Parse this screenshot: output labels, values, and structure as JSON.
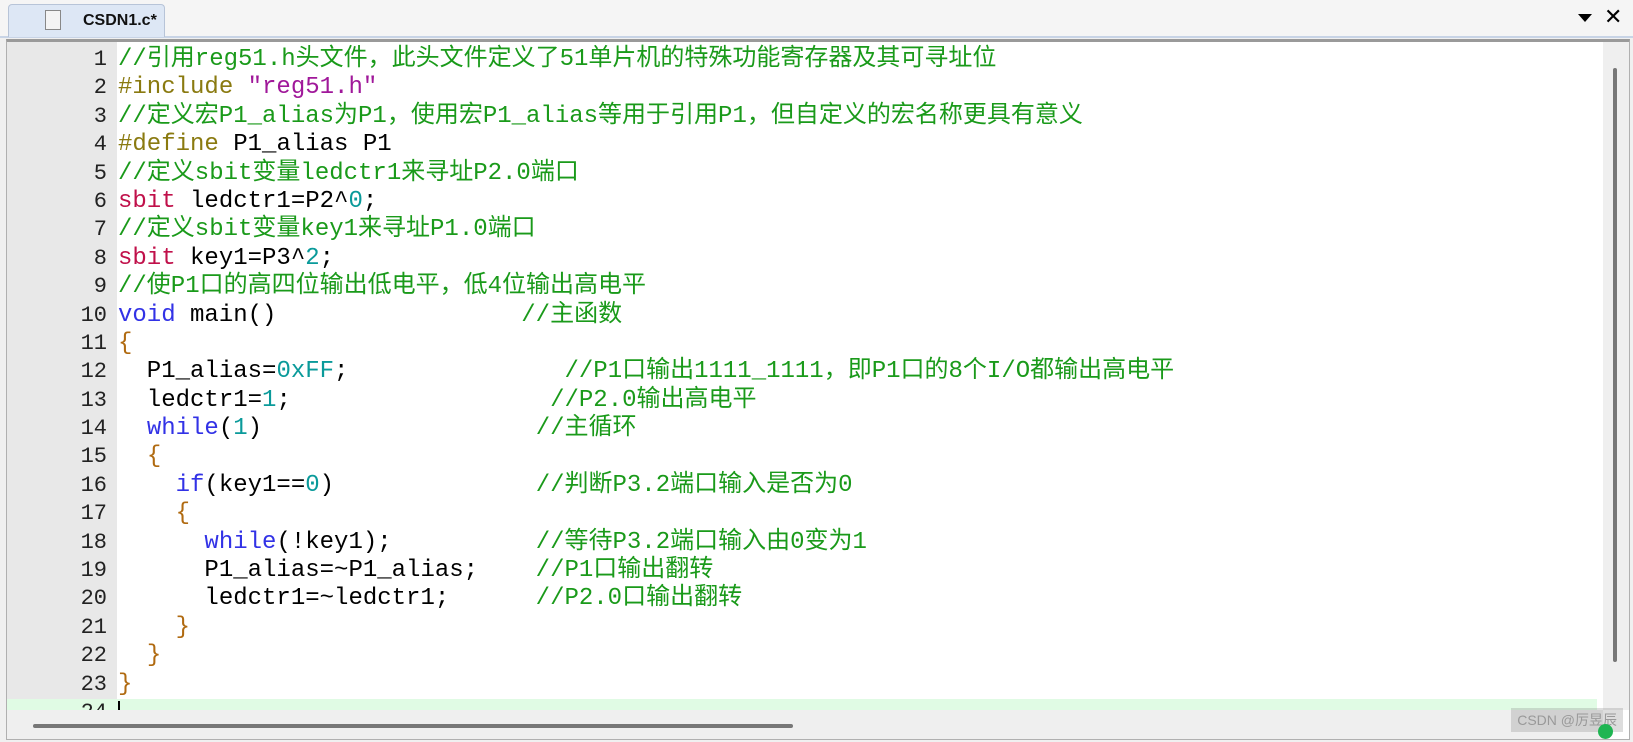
{
  "tab": {
    "title": "CSDN1.c*"
  },
  "watermark": "CSDN @厉昱辰",
  "colors": {
    "comment": "#1a9a1a",
    "keyword": "#3232e6",
    "type": "#c0104a",
    "preprocessor": "#8a7a10",
    "string": "#a0189a",
    "number": "#0a9a9a",
    "current_line": "#e0fbe4"
  },
  "editor": {
    "current_line": 24,
    "lines": [
      [
        [
          "comment",
          "//引用reg51.h头文件，此头文件定义了51单片机的特殊功能寄存器及其可寻址位"
        ]
      ],
      [
        [
          "pre",
          "#include "
        ],
        [
          "string",
          "\"reg51.h\""
        ]
      ],
      [
        [
          "comment",
          "//定义宏P1_alias为P1，使用宏P1_alias等用于引用P1，但自定义的宏名称更具有意义"
        ]
      ],
      [
        [
          "pre",
          "#define"
        ],
        [
          "plain",
          " P1_alias P1"
        ]
      ],
      [
        [
          "comment",
          "//定义sbit变量ledctr1来寻址P2.0端口"
        ]
      ],
      [
        [
          "type",
          "sbit"
        ],
        [
          "plain",
          " ledctr1=P2^"
        ],
        [
          "number",
          "0"
        ],
        [
          "plain",
          ";"
        ]
      ],
      [
        [
          "comment",
          "//定义sbit变量key1来寻址P1.0端口"
        ]
      ],
      [
        [
          "type",
          "sbit"
        ],
        [
          "plain",
          " key1=P3^"
        ],
        [
          "number",
          "2"
        ],
        [
          "plain",
          ";"
        ]
      ],
      [
        [
          "comment",
          "//使P1口的高四位输出低电平，低4位输出高电平"
        ]
      ],
      [
        [
          "keyword",
          "void"
        ],
        [
          "plain",
          " main()                 "
        ],
        [
          "comment",
          "//主函数"
        ]
      ],
      [
        [
          "brace",
          "{"
        ]
      ],
      [
        [
          "plain",
          "  P1_alias="
        ],
        [
          "number",
          "0xFF"
        ],
        [
          "plain",
          ";               "
        ],
        [
          "comment",
          "//P1口输出1111_1111，即P1口的8个I/O都输出高电平"
        ]
      ],
      [
        [
          "plain",
          "  ledctr1="
        ],
        [
          "number",
          "1"
        ],
        [
          "plain",
          ";                  "
        ],
        [
          "comment",
          "//P2.0输出高电平"
        ]
      ],
      [
        [
          "plain",
          "  "
        ],
        [
          "keyword",
          "while"
        ],
        [
          "plain",
          "("
        ],
        [
          "number",
          "1"
        ],
        [
          "plain",
          ")                   "
        ],
        [
          "comment",
          "//主循环"
        ]
      ],
      [
        [
          "plain",
          "  "
        ],
        [
          "brace",
          "{"
        ]
      ],
      [
        [
          "plain",
          "    "
        ],
        [
          "keyword",
          "if"
        ],
        [
          "plain",
          "(key1=="
        ],
        [
          "number",
          "0"
        ],
        [
          "plain",
          ")              "
        ],
        [
          "comment",
          "//判断P3.2端口输入是否为0"
        ]
      ],
      [
        [
          "plain",
          "    "
        ],
        [
          "brace",
          "{"
        ]
      ],
      [
        [
          "plain",
          "      "
        ],
        [
          "keyword",
          "while"
        ],
        [
          "plain",
          "(!key1);          "
        ],
        [
          "comment",
          "//等待P3.2端口输入由0变为1"
        ]
      ],
      [
        [
          "plain",
          "      P1_alias=~P1_alias;    "
        ],
        [
          "comment",
          "//P1口输出翻转"
        ]
      ],
      [
        [
          "plain",
          "      ledctr1=~ledctr1;      "
        ],
        [
          "comment",
          "//P2.0口输出翻转"
        ]
      ],
      [
        [
          "plain",
          "    "
        ],
        [
          "brace",
          "}"
        ]
      ],
      [
        [
          "plain",
          "  "
        ],
        [
          "brace",
          "}"
        ]
      ],
      [
        [
          "brace",
          "}"
        ]
      ],
      []
    ]
  }
}
